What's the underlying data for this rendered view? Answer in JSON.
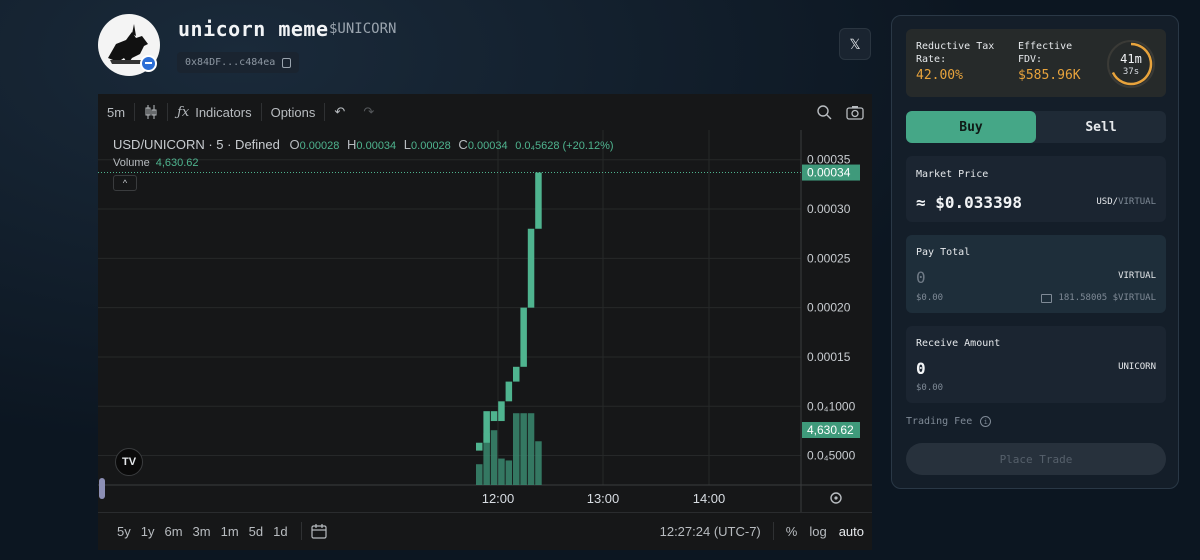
{
  "token": {
    "name": "unicorn meme",
    "ticker": "$UNICORN",
    "address_short": "0x84DF...c484ea"
  },
  "header": {
    "x_label": "𝕏"
  },
  "toolbar": {
    "interval": "5m",
    "indicators_label": "Indicators",
    "options_label": "Options"
  },
  "chart_header": {
    "symbol": "USD/UNICORN · 5 · Defined",
    "o_label": "O",
    "o_value": "0.00028",
    "h_label": "H",
    "h_value": "0.00034",
    "l_label": "L",
    "l_value": "0.00028",
    "c_label": "C",
    "c_value": "0.00034",
    "change": "0.0₄5628 (+20.12%)",
    "volume_label": "Volume",
    "volume_value": "4,630.62",
    "collapse_glyph": "^"
  },
  "chart_data": {
    "type": "candlestick",
    "price_axis_ticks": [
      "0.00035",
      "0.00030",
      "0.00025",
      "0.00020",
      "0.00015",
      "0.0₄1000",
      "0.0₄5000"
    ],
    "price_axis_tick_values": [
      0.00035,
      0.0003,
      0.00025,
      0.0002,
      0.00015,
      0.0001,
      5e-05
    ],
    "time_axis_ticks": [
      "12:00",
      "13:00",
      "14:00"
    ],
    "last_price_label": "0.00034",
    "last_price": 0.000337,
    "last_volume_label": "4,630.62",
    "ylim": [
      1e-05,
      0.00037
    ],
    "candles": [
      {
        "o": 5.5e-05,
        "c": 6.3e-05,
        "h": 6.3e-05,
        "l": 5.5e-05
      },
      {
        "o": 6.3e-05,
        "c": 9.5e-05,
        "h": 9.5e-05,
        "l": 6.3e-05
      },
      {
        "o": 9.5e-05,
        "c": 8.5e-05,
        "h": 9.5e-05,
        "l": 8.5e-05
      },
      {
        "o": 8.5e-05,
        "c": 0.000105,
        "h": 0.000105,
        "l": 8.5e-05
      },
      {
        "o": 0.000105,
        "c": 0.000125,
        "h": 0.000125,
        "l": 0.000105
      },
      {
        "o": 0.000125,
        "c": 0.00014,
        "h": 0.00014,
        "l": 0.000125
      },
      {
        "o": 0.00014,
        "c": 0.0002,
        "h": 0.0002,
        "l": 0.00014
      },
      {
        "o": 0.0002,
        "c": 0.00028,
        "h": 0.00028,
        "l": 0.0002
      },
      {
        "o": 0.00028,
        "c": 0.000337,
        "h": 0.000337,
        "l": 0.00028
      }
    ],
    "volumes": [
      2200,
      5500,
      5800,
      2800,
      2600,
      7600,
      7600,
      7600,
      4630.62
    ],
    "volume_max": 9000,
    "up_color": "#4fb48f",
    "volume_color": "#3a8a70"
  },
  "bottom_bar": {
    "ranges": [
      "5y",
      "1y",
      "6m",
      "3m",
      "1m",
      "5d",
      "1d"
    ],
    "time": "12:27:24 (UTC-7)",
    "percent": "%",
    "log": "log",
    "auto": "auto"
  },
  "trade": {
    "tax_label": "Reductive Tax Rate:",
    "tax_value": "42.00%",
    "fdv_label": "Effective FDV:",
    "fdv_value": "$585.96K",
    "timer_main": "41m",
    "timer_sub": "37s",
    "timer_fraction": 0.68,
    "buy_label": "Buy",
    "sell_label": "Sell",
    "market_price_label": "Market Price",
    "market_price_value": "≈ $0.033398",
    "market_price_unit_a": "USD/",
    "market_price_unit_b": "VIRTUAL",
    "pay_total_label": "Pay Total",
    "pay_total_value": "0",
    "pay_total_unit": "VIRTUAL",
    "pay_total_usd": "$0.00",
    "pay_balance": "181.58005 $VIRTUAL",
    "receive_label": "Receive Amount",
    "receive_value": "0",
    "receive_unit": "UNICORN",
    "receive_usd": "$0.00",
    "fee_label": "Trading Fee",
    "place_trade_label": "Place Trade"
  }
}
